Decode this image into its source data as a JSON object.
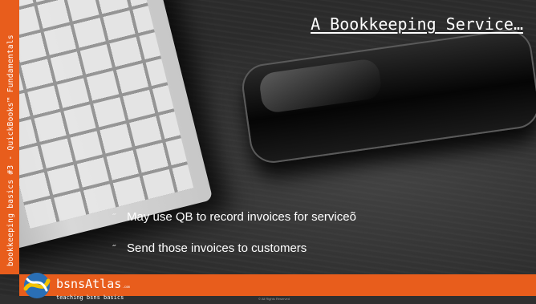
{
  "slide": {
    "title": "A Bookkeeping Service…",
    "side_label": "bookkeeping basics #3 - QuickBooks™ Fundamentals",
    "bullets": [
      {
        "marker": "˝",
        "text": "May use QB to record invoices for serviceõ"
      },
      {
        "marker": "˝",
        "text": "Send those invoices to customers"
      }
    ]
  },
  "footer": {
    "brand_name": "bsnsAtlas",
    "brand_suffix": ".com",
    "tagline": "teaching bsns basics",
    "copyright": "© All Rights Reserved"
  },
  "colors": {
    "accent": "#e85d1c",
    "background": "#2b2b2b",
    "text": "#ffffff"
  },
  "icons": {
    "logo": "globe-logo-icon"
  }
}
